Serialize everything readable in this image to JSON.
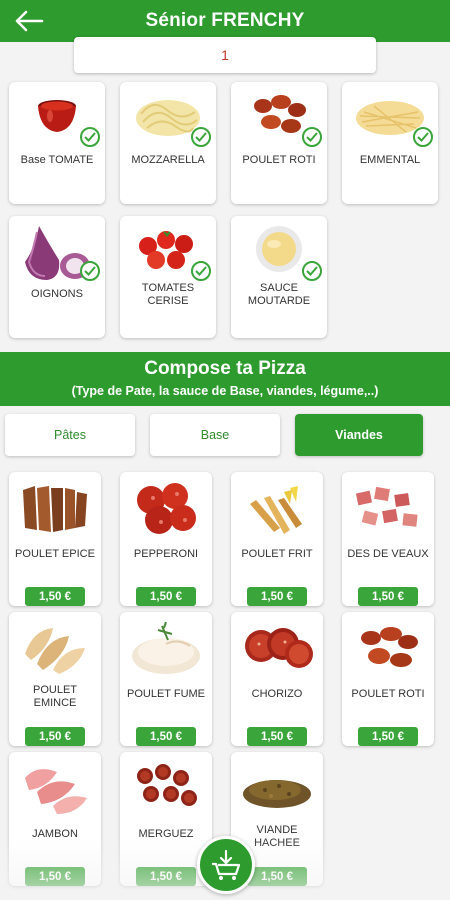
{
  "header": {
    "title": "Sénior FRENCHY",
    "back_icon": "arrow-left-icon"
  },
  "quantity": {
    "value": "1"
  },
  "selected_ingredients": [
    {
      "label": "Base TOMATE",
      "icon": "tomato-sauce-icon",
      "selected": true
    },
    {
      "label": "MOZZARELLA",
      "icon": "mozzarella-icon",
      "selected": true
    },
    {
      "label": "POULET ROTI",
      "icon": "roast-chicken-icon",
      "selected": true
    },
    {
      "label": "EMMENTAL",
      "icon": "emmental-icon",
      "selected": true
    },
    {
      "label": "OIGNONS",
      "icon": "onion-icon",
      "selected": true
    },
    {
      "label": "TOMATES\nCERISE",
      "icon": "cherry-tomato-icon",
      "selected": true
    },
    {
      "label": "SAUCE\nMOUTARDE",
      "icon": "mustard-sauce-icon",
      "selected": true
    }
  ],
  "section": {
    "title": "Compose ta Pizza",
    "subtitle": "(Type de Pate, la sauce de Base, viandes, légume,..)"
  },
  "tabs": [
    {
      "label": "Pâtes",
      "active": false
    },
    {
      "label": "Base",
      "active": false
    },
    {
      "label": "Viandes",
      "active": true
    }
  ],
  "products": [
    {
      "label": "POULET EPICE",
      "price": "1,50 €",
      "icon": "spicy-chicken-icon"
    },
    {
      "label": "PEPPERONI",
      "price": "1,50 €",
      "icon": "pepperoni-icon"
    },
    {
      "label": "POULET FRIT",
      "price": "1,50 €",
      "icon": "fried-chicken-icon"
    },
    {
      "label": "DES DE VEAUX",
      "price": "1,50 €",
      "icon": "veal-cubes-icon"
    },
    {
      "label": "POULET\nEMINCE",
      "price": "1,50 €",
      "icon": "sliced-chicken-icon"
    },
    {
      "label": "POULET FUME",
      "price": "1,50 €",
      "icon": "smoked-chicken-icon"
    },
    {
      "label": "CHORIZO",
      "price": "1,50 €",
      "icon": "chorizo-icon"
    },
    {
      "label": "POULET ROTI",
      "price": "1,50 €",
      "icon": "roast-chicken-icon"
    },
    {
      "label": "JAMBON",
      "price": "1,50 €",
      "icon": "ham-icon"
    },
    {
      "label": "MERGUEZ",
      "price": "1,50 €",
      "icon": "merguez-icon"
    },
    {
      "label": "VIANDE\nHACHEE",
      "price": "1,50 €",
      "icon": "ground-meat-icon"
    }
  ],
  "cart": {
    "icon": "cart-download-icon"
  },
  "colors": {
    "primary_green": "#2e9b2e",
    "price_green": "#3aa53a",
    "quantity_red": "#c0392b"
  }
}
